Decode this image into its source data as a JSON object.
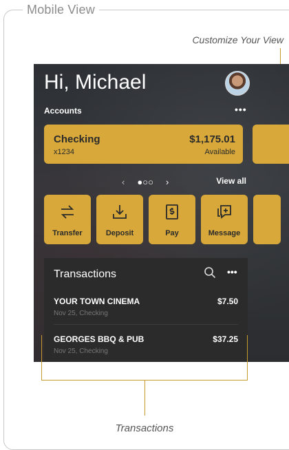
{
  "frame": {
    "title": "Mobile View"
  },
  "annotations": {
    "top": "Customize Your View",
    "bottom": "Transactions"
  },
  "app": {
    "greeting": "Hi, Michael",
    "accounts_label": "Accounts",
    "more_label": "•••",
    "card": {
      "name": "Checking",
      "number": "x1234",
      "balance": "$1,175.01",
      "balance_label": "Available"
    },
    "pager": {
      "prev": "‹",
      "dots": "●○○",
      "next": "›"
    },
    "view_all": "View all",
    "actions": [
      {
        "label": "Transfer",
        "icon": "transfer-icon"
      },
      {
        "label": "Deposit",
        "icon": "deposit-icon"
      },
      {
        "label": "Pay",
        "icon": "pay-icon"
      },
      {
        "label": "Message",
        "icon": "message-icon"
      }
    ],
    "transactions": {
      "title": "Transactions",
      "more_label": "•••",
      "items": [
        {
          "merchant": "YOUR TOWN CINEMA",
          "detail": "Nov 25, Checking",
          "amount": "$7.50"
        },
        {
          "merchant": "GEORGES BBQ & PUB",
          "detail": "Nov 25, Checking",
          "amount": "$37.25"
        }
      ]
    }
  },
  "colors": {
    "accent": "#d8a93a",
    "annotation_line": "#c69a2b"
  }
}
